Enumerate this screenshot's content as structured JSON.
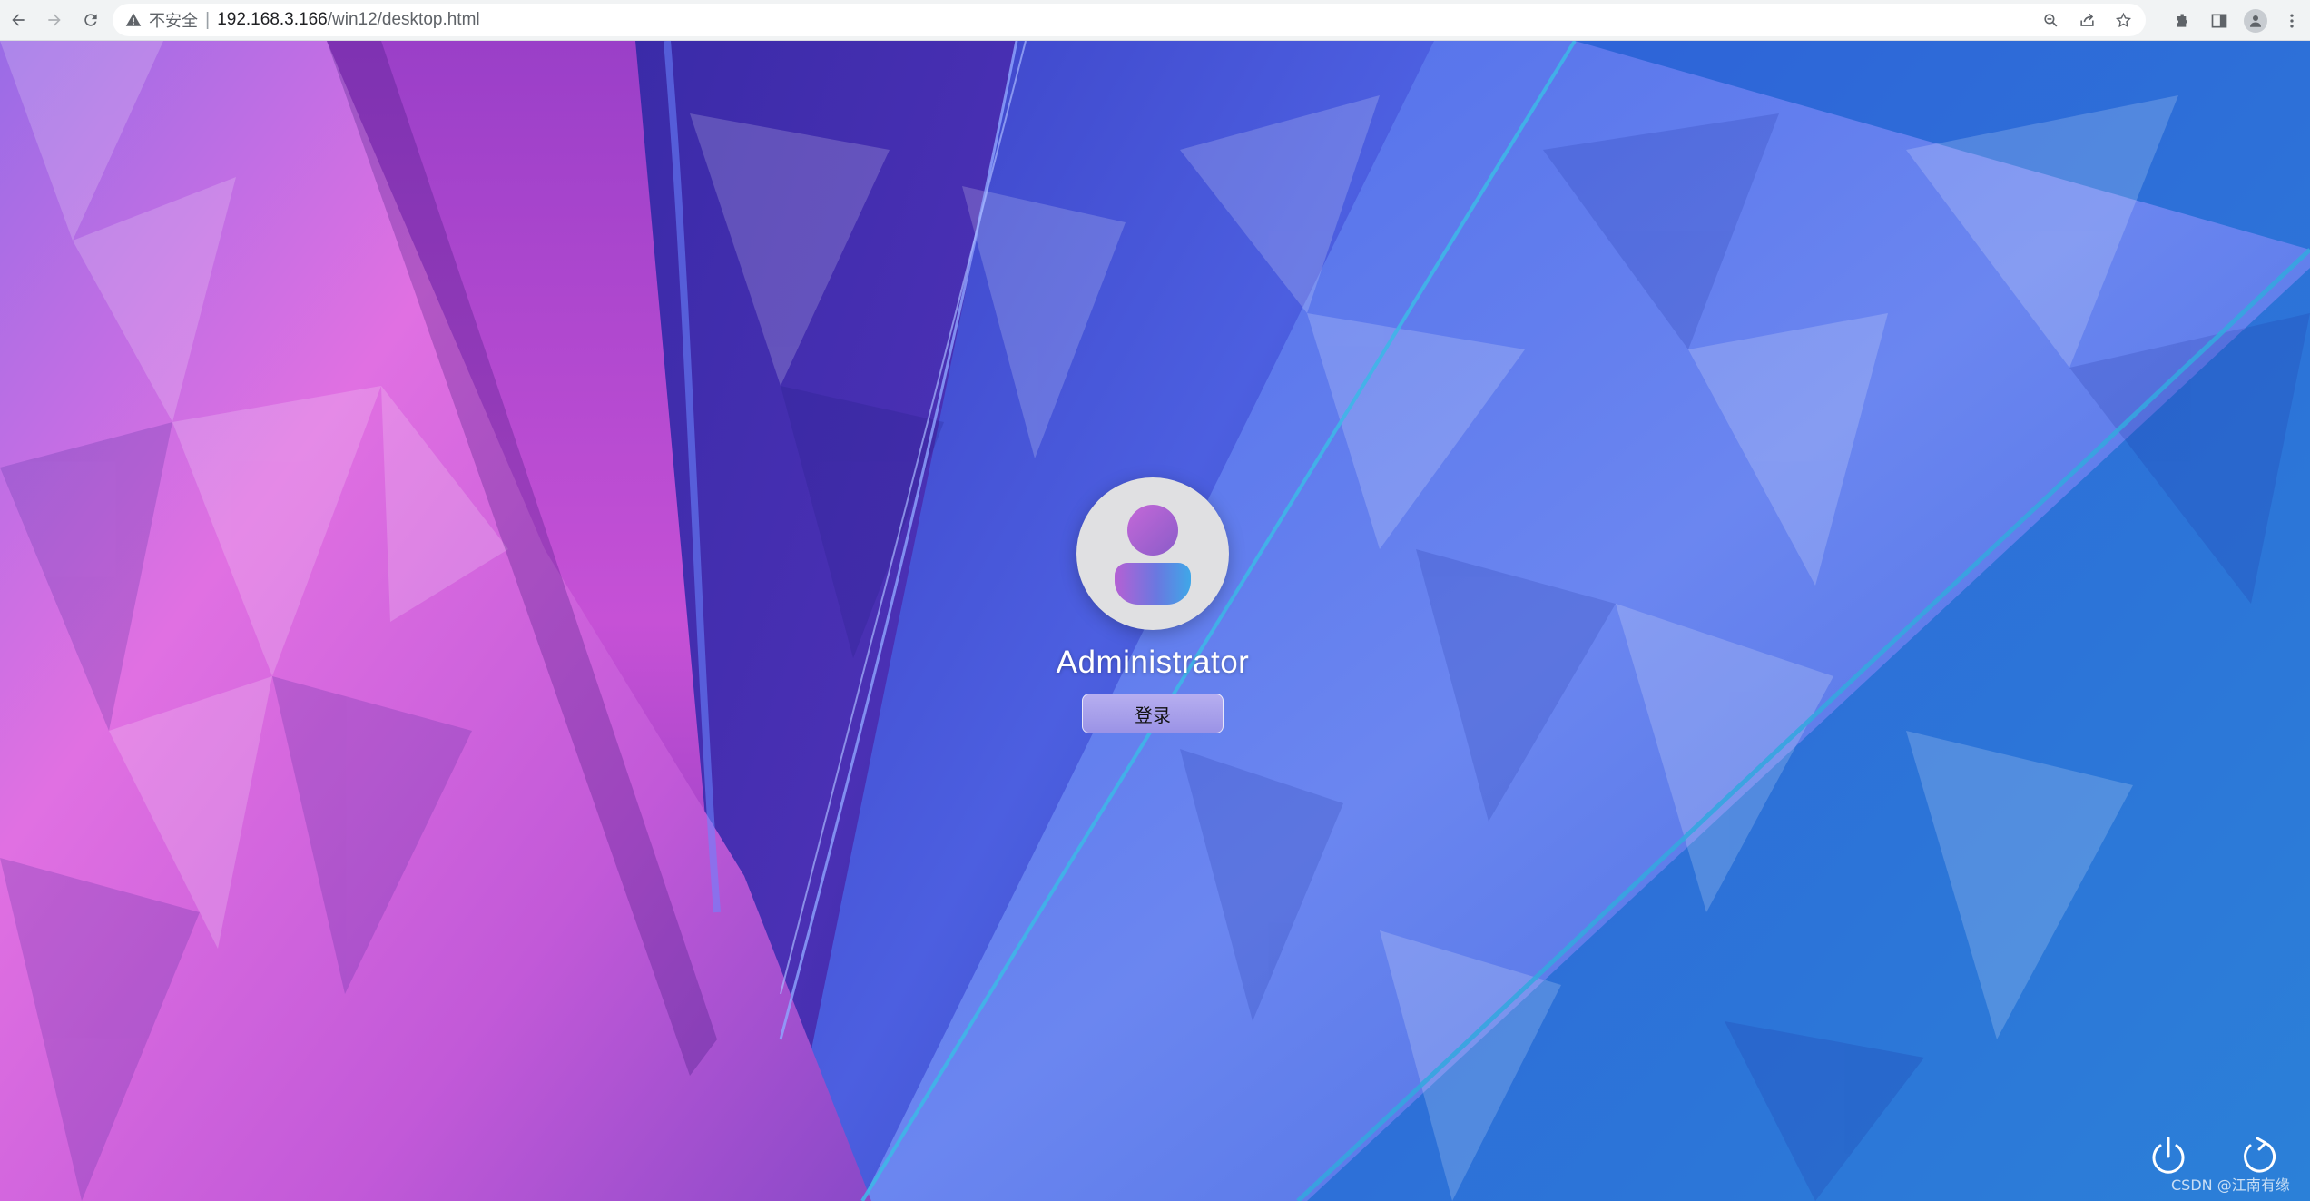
{
  "browser": {
    "security_label": "不安全",
    "separator": "|",
    "url_host": "192.168.3.166",
    "url_path": "/win12/desktop.html",
    "icons": [
      "back-icon",
      "forward-icon",
      "reload-icon",
      "warning-icon",
      "zoom-icon",
      "share-icon",
      "bookmark-star-icon",
      "extensions-icon",
      "side-panel-icon",
      "profile-icon",
      "menu-kebab-icon"
    ]
  },
  "login": {
    "username": "Administrator",
    "button_label": "登录"
  },
  "controls": {
    "icons": [
      "power-icon",
      "restart-icon"
    ]
  },
  "watermark": "CSDN @江南有缘",
  "colors": {
    "pink": "#d968e0",
    "purple": "#4a2fb0",
    "blue": "#3c5fe0",
    "accent_line": "#3fb6e8"
  }
}
